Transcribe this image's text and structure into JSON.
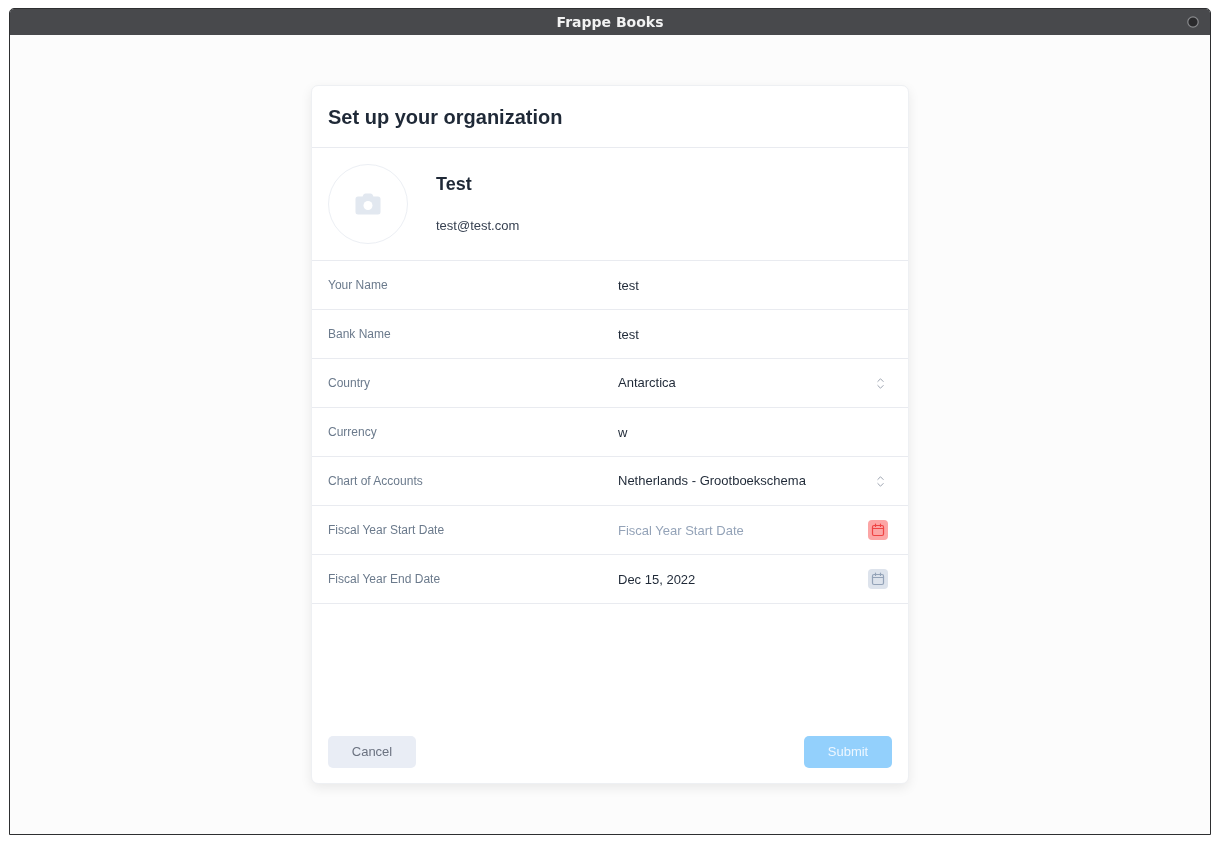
{
  "window": {
    "title": "Frappe Books"
  },
  "dialog": {
    "title": "Set up your organization",
    "profile": {
      "name": "Test",
      "email": "test@test.com"
    },
    "fields": [
      {
        "label": "Your Name",
        "kind": "text",
        "value": "test"
      },
      {
        "label": "Bank Name",
        "kind": "text",
        "value": "test"
      },
      {
        "label": "Country",
        "kind": "select",
        "value": "Antarctica"
      },
      {
        "label": "Currency",
        "kind": "text",
        "value": "w"
      },
      {
        "label": "Chart of Accounts",
        "kind": "select",
        "value": "Netherlands - Grootboekschema"
      },
      {
        "label": "Fiscal Year Start Date",
        "kind": "date",
        "placeholder": "Fiscal Year Start Date",
        "error": true
      },
      {
        "label": "Fiscal Year End Date",
        "kind": "date",
        "value": "Dec 15, 2022",
        "error": false
      }
    ],
    "buttons": [
      {
        "label": "Cancel",
        "kind": "secondary",
        "disabled": false
      },
      {
        "label": "Submit",
        "kind": "primary",
        "disabled": true
      }
    ]
  }
}
